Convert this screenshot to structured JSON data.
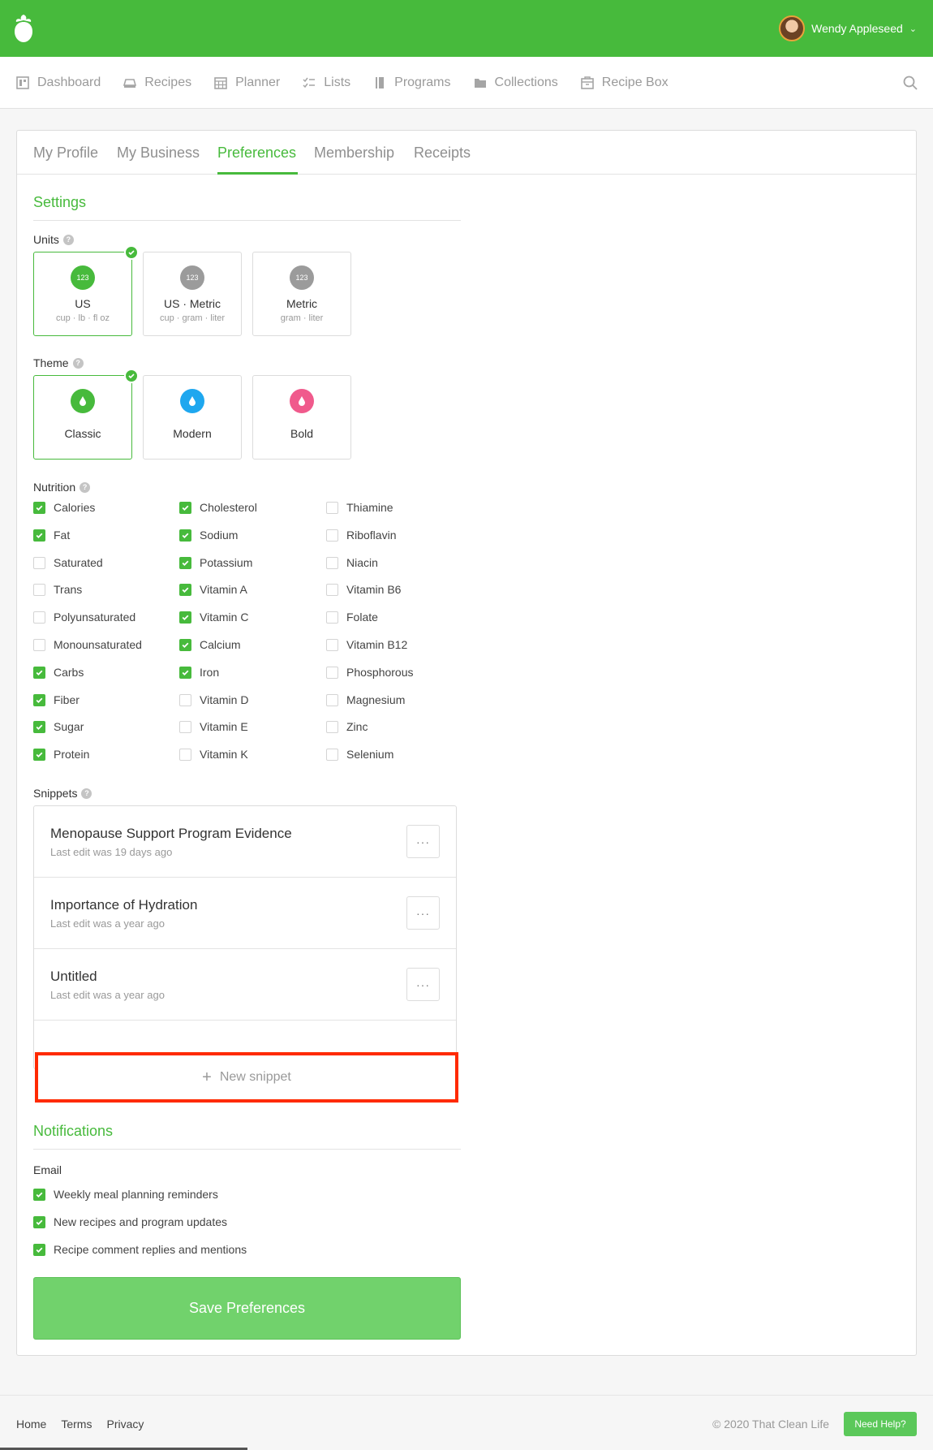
{
  "user": {
    "name": "Wendy Appleseed"
  },
  "nav": [
    "Dashboard",
    "Recipes",
    "Planner",
    "Lists",
    "Programs",
    "Collections",
    "Recipe Box"
  ],
  "tabs": [
    "My Profile",
    "My Business",
    "Preferences",
    "Membership",
    "Receipts"
  ],
  "active_tab": "Preferences",
  "settings": {
    "title": "Settings",
    "units_label": "Units",
    "units": [
      {
        "badge": "123",
        "name": "US",
        "sub": "cup · lb · fl oz",
        "selected": true,
        "color": "#47ba3c"
      },
      {
        "badge": "123",
        "name": "US · Metric",
        "sub": "cup · gram · liter",
        "selected": false,
        "color": "#9b9b9b"
      },
      {
        "badge": "123",
        "name": "Metric",
        "sub": "gram · liter",
        "selected": false,
        "color": "#9b9b9b"
      }
    ],
    "theme_label": "Theme",
    "themes": [
      {
        "name": "Classic",
        "selected": true,
        "color": "#47ba3c"
      },
      {
        "name": "Modern",
        "selected": false,
        "color": "#1ea7ef"
      },
      {
        "name": "Bold",
        "selected": false,
        "color": "#f05a8c"
      }
    ],
    "nutrition_label": "Nutrition",
    "nutrition": [
      [
        {
          "label": "Calories",
          "checked": true
        },
        {
          "label": "Fat",
          "checked": true
        },
        {
          "label": "Saturated",
          "checked": false
        },
        {
          "label": "Trans",
          "checked": false
        },
        {
          "label": "Polyunsaturated",
          "checked": false
        },
        {
          "label": "Monounsaturated",
          "checked": false
        },
        {
          "label": "Carbs",
          "checked": true
        },
        {
          "label": "Fiber",
          "checked": true
        },
        {
          "label": "Sugar",
          "checked": true
        },
        {
          "label": "Protein",
          "checked": true
        }
      ],
      [
        {
          "label": "Cholesterol",
          "checked": true
        },
        {
          "label": "Sodium",
          "checked": true
        },
        {
          "label": "Potassium",
          "checked": true
        },
        {
          "label": "Vitamin A",
          "checked": true
        },
        {
          "label": "Vitamin C",
          "checked": true
        },
        {
          "label": "Calcium",
          "checked": true
        },
        {
          "label": "Iron",
          "checked": true
        },
        {
          "label": "Vitamin D",
          "checked": false
        },
        {
          "label": "Vitamin E",
          "checked": false
        },
        {
          "label": "Vitamin K",
          "checked": false
        }
      ],
      [
        {
          "label": "Thiamine",
          "checked": false
        },
        {
          "label": "Riboflavin",
          "checked": false
        },
        {
          "label": "Niacin",
          "checked": false
        },
        {
          "label": "Vitamin B6",
          "checked": false
        },
        {
          "label": "Folate",
          "checked": false
        },
        {
          "label": "Vitamin B12",
          "checked": false
        },
        {
          "label": "Phosphorous",
          "checked": false
        },
        {
          "label": "Magnesium",
          "checked": false
        },
        {
          "label": "Zinc",
          "checked": false
        },
        {
          "label": "Selenium",
          "checked": false
        }
      ]
    ],
    "snippets_label": "Snippets",
    "snippets": [
      {
        "title": "Menopause Support Program Evidence",
        "subtitle": "Last edit was 19 days ago",
        "more": "···"
      },
      {
        "title": "Importance of Hydration",
        "subtitle": "Last edit was a year ago",
        "more": "···"
      },
      {
        "title": "Untitled",
        "subtitle": "Last edit was a year ago",
        "more": "···"
      }
    ],
    "new_snippet": "New snippet"
  },
  "notifications": {
    "title": "Notifications",
    "email_label": "Email",
    "items": [
      {
        "label": "Weekly meal planning reminders",
        "checked": true
      },
      {
        "label": "New recipes and program updates",
        "checked": true
      },
      {
        "label": "Recipe comment replies and mentions",
        "checked": true
      }
    ]
  },
  "save_label": "Save Preferences",
  "footer": {
    "links": [
      "Home",
      "Terms",
      "Privacy"
    ],
    "copyright": "© 2020 That Clean Life",
    "help": "Need Help?"
  },
  "colors": {
    "brand": "#47ba3c",
    "highlight": "#ff2a00",
    "save": "#71d26c"
  }
}
